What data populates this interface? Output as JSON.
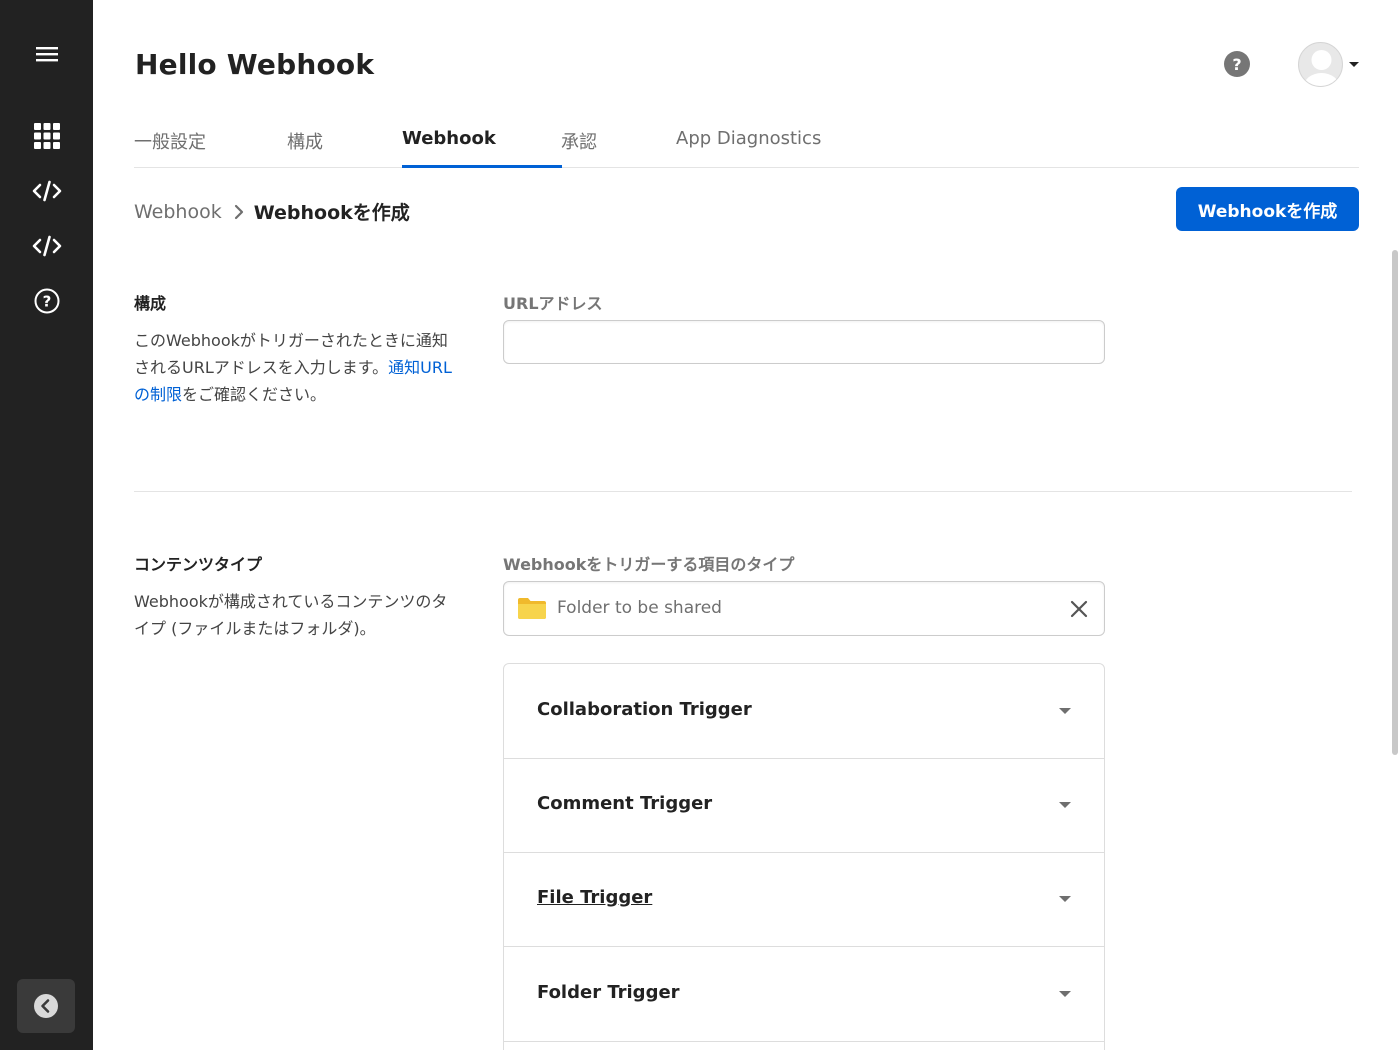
{
  "sidebar": {
    "items": [
      {
        "name": "menu-icon"
      },
      {
        "name": "apps-grid-icon"
      },
      {
        "name": "code-icon"
      },
      {
        "name": "code-icon"
      },
      {
        "name": "help-circle-icon"
      }
    ],
    "collapse_icon": "chevron-left-icon"
  },
  "header": {
    "title": "Hello Webhook",
    "help_label": "?"
  },
  "tabs": [
    {
      "label": "一般設定",
      "active": false
    },
    {
      "label": "構成",
      "active": false
    },
    {
      "label": "Webhook",
      "active": true
    },
    {
      "label": "承認",
      "active": false
    },
    {
      "label": "App Diagnostics",
      "active": false
    }
  ],
  "breadcrumb": {
    "parent": "Webhook",
    "current": "Webhookを作成"
  },
  "create_button": "Webhookを作成",
  "config_section": {
    "title": "構成",
    "desc_before": "このWebhookがトリガーされたときに通知されるURLアドレスを入力します。",
    "desc_link": "通知URLの制限",
    "desc_after": "をご確認ください。",
    "url_label": "URLアドレス",
    "url_value": "",
    "url_placeholder": ""
  },
  "content_section": {
    "title": "コンテンツタイプ",
    "desc": "Webhookが構成されているコンテンツのタイプ (ファイルまたはフォルダ)。",
    "type_label": "Webhookをトリガーする項目のタイプ",
    "type_value": "Folder to be shared",
    "triggers": [
      {
        "label": "Collaboration Trigger"
      },
      {
        "label": "Comment Trigger"
      },
      {
        "label": "File Trigger"
      },
      {
        "label": "Folder Trigger"
      }
    ]
  },
  "colors": {
    "sidebar_bg": "#222222",
    "accent": "#0061d5",
    "folder": "#f7c948"
  }
}
